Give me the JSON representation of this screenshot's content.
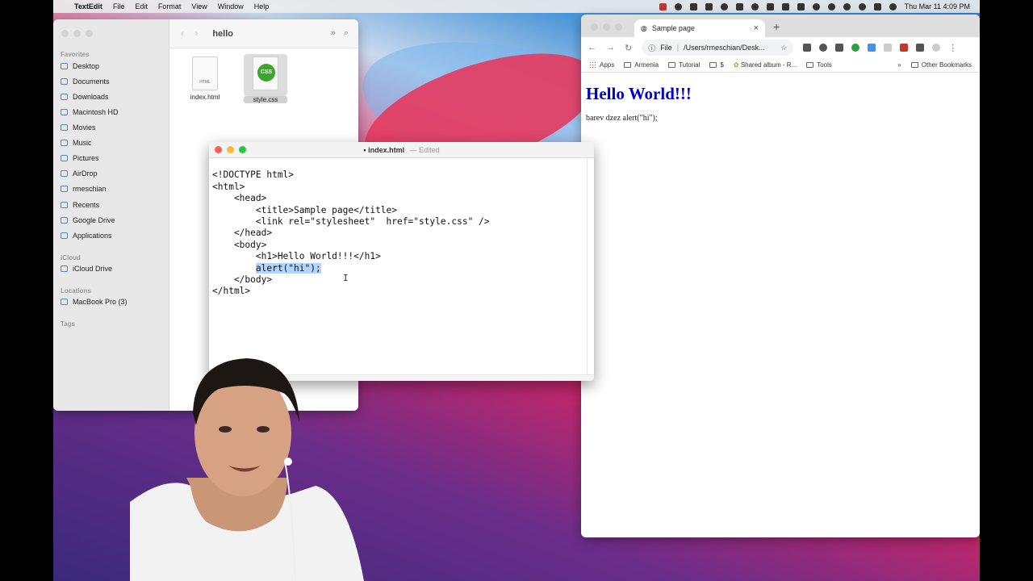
{
  "menubar": {
    "app": "TextEdit",
    "menus": [
      "File",
      "Edit",
      "Format",
      "View",
      "Window",
      "Help"
    ],
    "datetime": "Thu Mar 11  4:09 PM"
  },
  "finder": {
    "title": "hello",
    "sections": {
      "favorites": "Favorites",
      "icloud": "iCloud",
      "locations": "Locations",
      "tags": "Tags"
    },
    "favorites": [
      "Desktop",
      "Documents",
      "Downloads",
      "Macintosh HD",
      "Movies",
      "Music",
      "Pictures",
      "AirDrop",
      "rmeschian",
      "Recents",
      "Google Drive",
      "Applications"
    ],
    "icloud_items": [
      "iCloud Drive"
    ],
    "location_items": [
      "MacBook Pro (3)"
    ],
    "files": [
      {
        "name": "index.html",
        "badge": "HTML"
      },
      {
        "name": "style.css",
        "badge": "CSS"
      }
    ]
  },
  "textedit": {
    "title": "index.html",
    "status": "— Edited",
    "lines": [
      "<!DOCTYPE html>",
      "<html>",
      "    <head>",
      "        <title>Sample page</title>",
      "",
      "        <link rel=\"stylesheet\"  href=\"style.css\" />",
      "    </head>",
      "    <body>",
      "        <h1>Hello World!!!</h1>",
      "",
      "        alert(\"hi\");",
      "    </body>",
      "</html>"
    ],
    "selected_indent": "        ",
    "selected_text": "alert(\"hi\");"
  },
  "browser": {
    "tab_title": "Sample page",
    "address_scheme": "File",
    "address_path": "/Users/rmeschian/Desk...",
    "bookmarks": [
      "Apps",
      "Armenia",
      "Tutorial",
      "$",
      "Shared album - R...",
      "Tools"
    ],
    "bookmarks_overflow": "»",
    "other_bookmarks": "Other Bookmarks",
    "page_h1": "Hello World!!!",
    "page_text": "barev dzez alert(\"hi\");"
  }
}
